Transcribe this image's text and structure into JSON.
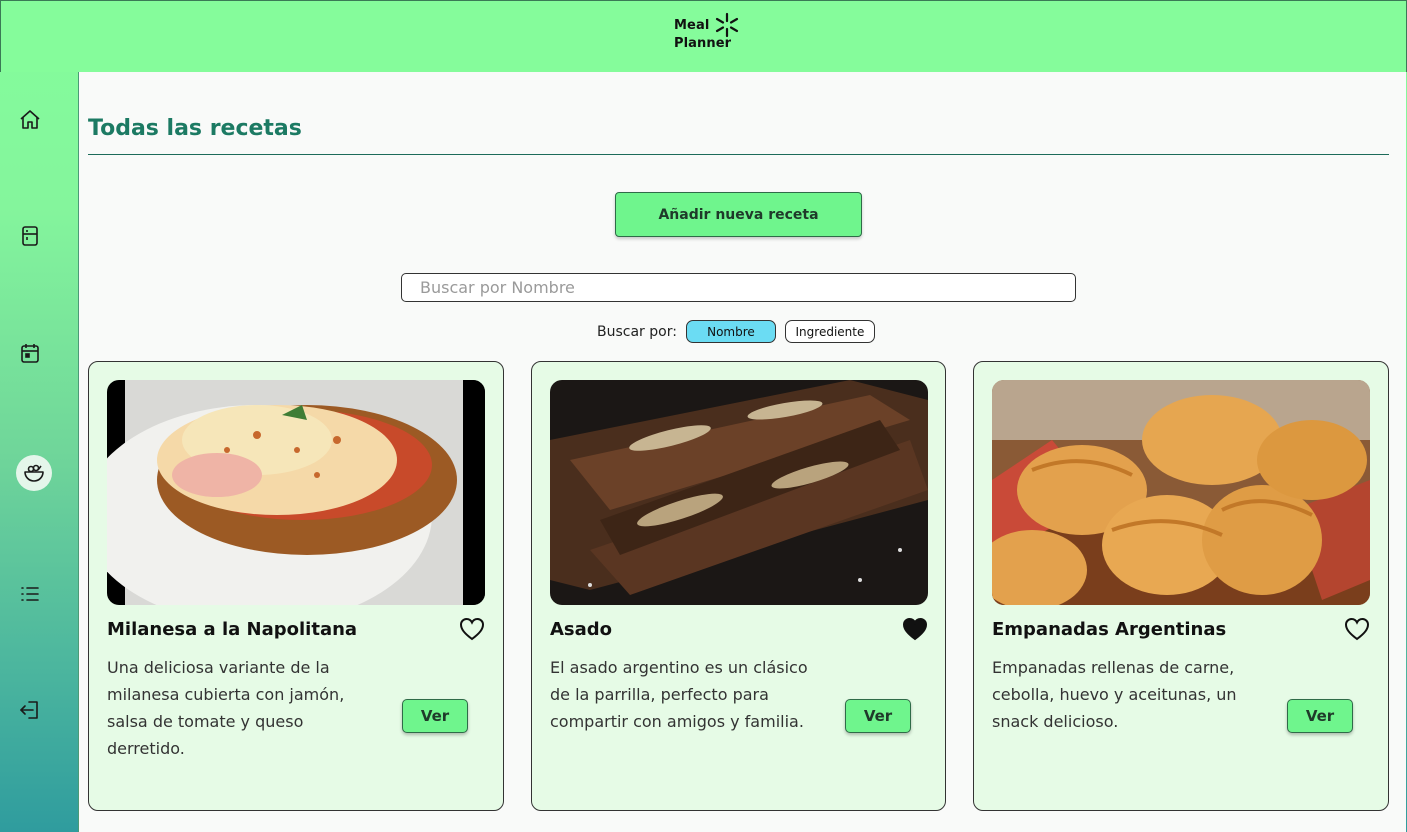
{
  "app": {
    "logo_line1": "Meal",
    "logo_line2": "Planner",
    "accent_color": "#85fc9b",
    "title_color": "#1c7a63"
  },
  "sidebar": {
    "items": [
      {
        "icon": "home-icon",
        "active": false
      },
      {
        "icon": "fridge-icon",
        "active": false
      },
      {
        "icon": "calendar-icon",
        "active": false
      },
      {
        "icon": "salad-bowl-icon",
        "active": true
      },
      {
        "icon": "list-icon",
        "active": false
      },
      {
        "icon": "logout-icon",
        "active": false
      }
    ]
  },
  "main": {
    "title": "Todas las recetas",
    "add_button": "Añadir nueva receta",
    "search": {
      "placeholder": "Buscar por Nombre",
      "value": ""
    },
    "search_by": {
      "label": "Buscar por:",
      "options": [
        {
          "label": "Nombre",
          "selected": true
        },
        {
          "label": "Ingrediente",
          "selected": false
        }
      ]
    },
    "recipes": [
      {
        "title": "Milanesa a la Napolitana",
        "description": "Una deliciosa variante de la milanesa cubierta con jamón, salsa de tomate y queso derretido.",
        "favorite": false,
        "button": "Ver"
      },
      {
        "title": "Asado",
        "description": "El asado argentino es un clásico de la parrilla, perfecto para compartir con amigos y familia.",
        "favorite": true,
        "button": "Ver"
      },
      {
        "title": "Empanadas Argentinas",
        "description": "Empanadas rellenas de carne, cebolla, huevo y aceitunas, un snack delicioso.",
        "favorite": false,
        "button": "Ver"
      }
    ]
  }
}
